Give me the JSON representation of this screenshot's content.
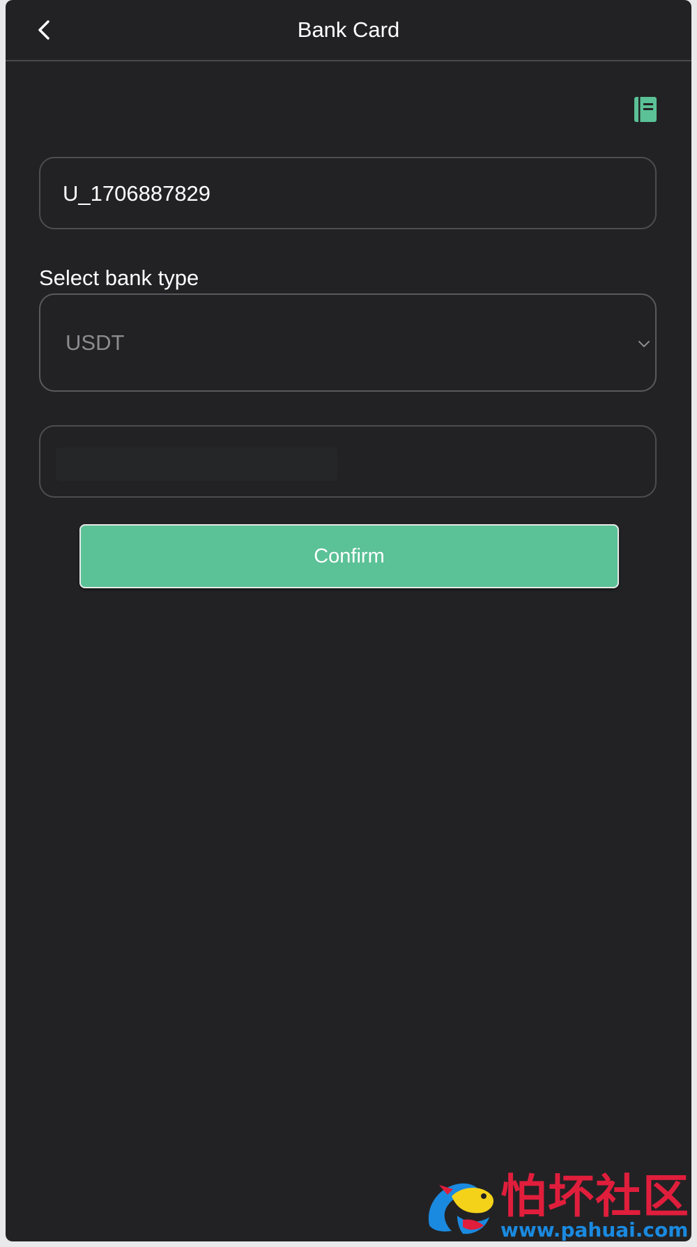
{
  "header": {
    "title": "Bank Card",
    "back_icon": "chevron-left-icon",
    "record_icon": "notebook-icon"
  },
  "form": {
    "account_value": "U_1706887829",
    "bank_type_label": "Select bank type",
    "bank_type_selected": "USDT",
    "address_value": ""
  },
  "actions": {
    "confirm_label": "Confirm"
  },
  "watermark": {
    "text_cn": "怕坏社区",
    "url": "www.pahuai.com"
  },
  "colors": {
    "background": "#222224",
    "accent": "#5bc196",
    "border": "#4d4d52",
    "text": "#ffffff",
    "muted_text": "#8c8c91"
  }
}
